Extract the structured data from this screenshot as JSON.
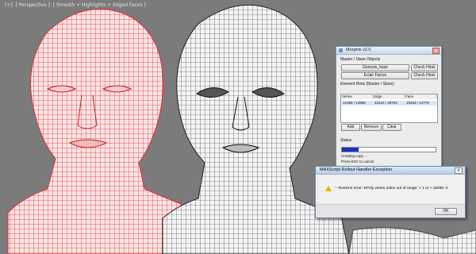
{
  "viewport": {
    "label_parts": [
      "[+]",
      "[ Perspective ]",
      "[ Smooth + Highlights + Edged Faces ]"
    ]
  },
  "morphix": {
    "title": "Morphix v2.0",
    "master_slave_label": "Master / Slave Objects",
    "master_object": "Genesis_base",
    "slave_object": "Eclair Farron",
    "check_hints_label": "Check Hints",
    "element_hints_label": "Element Hints (Master / Slave)",
    "columns": [
      "Vertex",
      "Edge",
      "Face"
    ],
    "row": [
      "12388 / 14888",
      "31615 / 29793",
      "19453 / 14779"
    ],
    "add_label": "Add",
    "remove_label": "Remove",
    "clear_label": "Clear",
    "status_label": "Status",
    "progress_fraction": 0.18,
    "status_line1": "Creating copy ...",
    "status_line2": "Press ESC to cancel."
  },
  "error_dialog": {
    "title": "MAXScript Rollout Handler Exception",
    "message": "-- Runtime error: EPoly vertex index out of range: < 1 or > 19286: 0",
    "ok_label": "OK",
    "close_glyph": "x"
  },
  "colors": {
    "viewport_bg": "#7b7b7b",
    "red_wire": "#e0303a",
    "dark_wire": "#2a2a2a",
    "progress_fill": "#1f2fbf",
    "warning": "#e8b400"
  }
}
